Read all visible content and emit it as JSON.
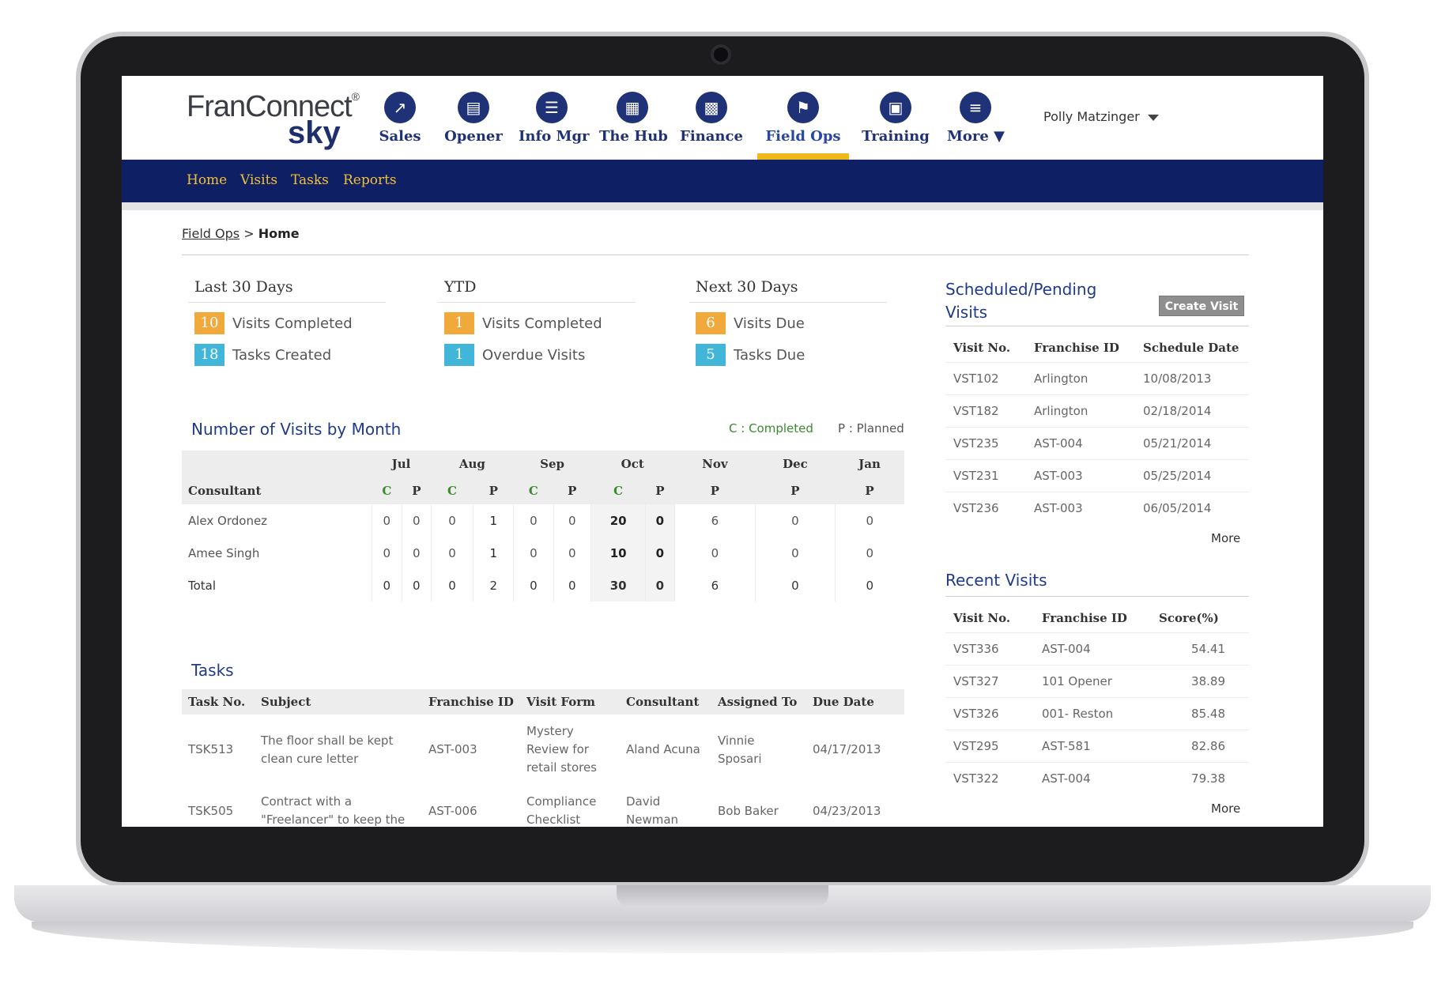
{
  "app": {
    "logo_top": "FranConnect",
    "logo_tm": "®",
    "logo_bottom": "sky"
  },
  "nav": [
    {
      "label": "Sales",
      "icon": "sales-chart-icon"
    },
    {
      "label": "Opener",
      "icon": "store-icon"
    },
    {
      "label": "Info Mgr",
      "icon": "info-list-icon"
    },
    {
      "label": "The Hub",
      "icon": "hub-document-icon"
    },
    {
      "label": "Finance",
      "icon": "finance-chart-icon"
    },
    {
      "label": "Field Ops",
      "icon": "field-ops-icon"
    },
    {
      "label": "Training",
      "icon": "training-icon"
    },
    {
      "label": "More",
      "icon": "menu-icon"
    }
  ],
  "user": {
    "name": "Polly Matzinger"
  },
  "subnav": {
    "home": "Home",
    "visits": "Visits",
    "tasks": "Tasks",
    "reports": "Reports"
  },
  "breadcrumb": {
    "parent": "Field Ops",
    "sep": ">",
    "current": "Home"
  },
  "stats": {
    "last30": {
      "title": "Last 30 Days",
      "r1_val": "10",
      "r1_label": "Visits Completed",
      "r2_val": "18",
      "r2_label": "Tasks Created"
    },
    "ytd": {
      "title": "YTD",
      "r1_val": "1",
      "r1_label": "Visits Completed",
      "r2_val": "1",
      "r2_label": "Overdue Visits"
    },
    "next30": {
      "title": "Next 30 Days",
      "r1_val": "6",
      "r1_label": "Visits Due",
      "r2_val": "5",
      "r2_label": "Tasks Due"
    }
  },
  "visits_by_month": {
    "title": "Number of Visits by Month",
    "legend_c": "C : Completed",
    "legend_p": "P : Planned",
    "months": [
      "Jul",
      "Aug",
      "Sep",
      "Oct",
      "Nov",
      "Dec",
      "Jan"
    ],
    "consultant_header": "Consultant",
    "sub": [
      "C",
      "P",
      "C",
      "P",
      "C",
      "P",
      "C",
      "P",
      "P",
      "P",
      "P"
    ],
    "rows": [
      {
        "name": "Alex Ordonez",
        "vals": [
          "0",
          "0",
          "0",
          "1",
          "0",
          "0",
          "20",
          "0",
          "6",
          "0",
          "0"
        ]
      },
      {
        "name": "Amee Singh",
        "vals": [
          "0",
          "0",
          "0",
          "1",
          "0",
          "0",
          "10",
          "0",
          "0",
          "0",
          "0"
        ]
      },
      {
        "name": "Total",
        "vals": [
          "0",
          "0",
          "0",
          "2",
          "0",
          "0",
          "30",
          "0",
          "6",
          "0",
          "0"
        ]
      }
    ]
  },
  "tasks": {
    "title": "Tasks",
    "headers": {
      "no": "Task No.",
      "subject": "Subject",
      "franchise": "Franchise ID",
      "form": "Visit Form",
      "consultant": "Consultant",
      "assigned": "Assigned To",
      "due": "Due Date"
    },
    "rows": [
      {
        "no": "TSK513",
        "subject": "The floor shall be kept clean cure letter",
        "franchise": "AST-003",
        "form": "Mystery Review for retail stores",
        "consultant": "Aland Acuna",
        "assigned": "Vinnie Sposari",
        "due": "04/17/2013"
      },
      {
        "no": "TSK505",
        "subject": "Contract with a \"Freelancer\" to keep the",
        "franchise": "AST-006",
        "form": "Compliance Checklist",
        "consultant": "David Newman",
        "assigned": "Bob Baker",
        "due": "04/23/2013"
      }
    ]
  },
  "scheduled": {
    "title": "Scheduled/Pending Visits",
    "create_label": "Create Visit",
    "headers": {
      "no": "Visit No.",
      "franchise": "Franchise ID",
      "date": "Schedule Date"
    },
    "rows": [
      {
        "no": "VST102",
        "franchise": "Arlington",
        "date": "10/08/2013"
      },
      {
        "no": "VST182",
        "franchise": "Arlington",
        "date": "02/18/2014"
      },
      {
        "no": "VST235",
        "franchise": "AST-004",
        "date": "05/21/2014"
      },
      {
        "no": "VST231",
        "franchise": "AST-003",
        "date": "05/25/2014"
      },
      {
        "no": "VST236",
        "franchise": "AST-003",
        "date": "06/05/2014"
      }
    ],
    "more": "More"
  },
  "recent": {
    "title": "Recent Visits",
    "headers": {
      "no": "Visit No.",
      "franchise": "Franchise ID",
      "score": "Score(%)"
    },
    "rows": [
      {
        "no": "VST336",
        "franchise": "AST-004",
        "score": "54.41"
      },
      {
        "no": "VST327",
        "franchise": "101 Opener",
        "score": "38.89"
      },
      {
        "no": "VST326",
        "franchise": "001- Reston",
        "score": "85.48"
      },
      {
        "no": "VST295",
        "franchise": "AST-581",
        "score": "82.86"
      },
      {
        "no": "VST322",
        "franchise": "AST-004",
        "score": "79.38"
      }
    ],
    "more": "More"
  },
  "colors": {
    "navy": "#0f1f63",
    "gold": "#f1b81c",
    "orange_badge": "#f1a93b",
    "blue_badge": "#42b6d8",
    "link": "#2a5bc9"
  }
}
